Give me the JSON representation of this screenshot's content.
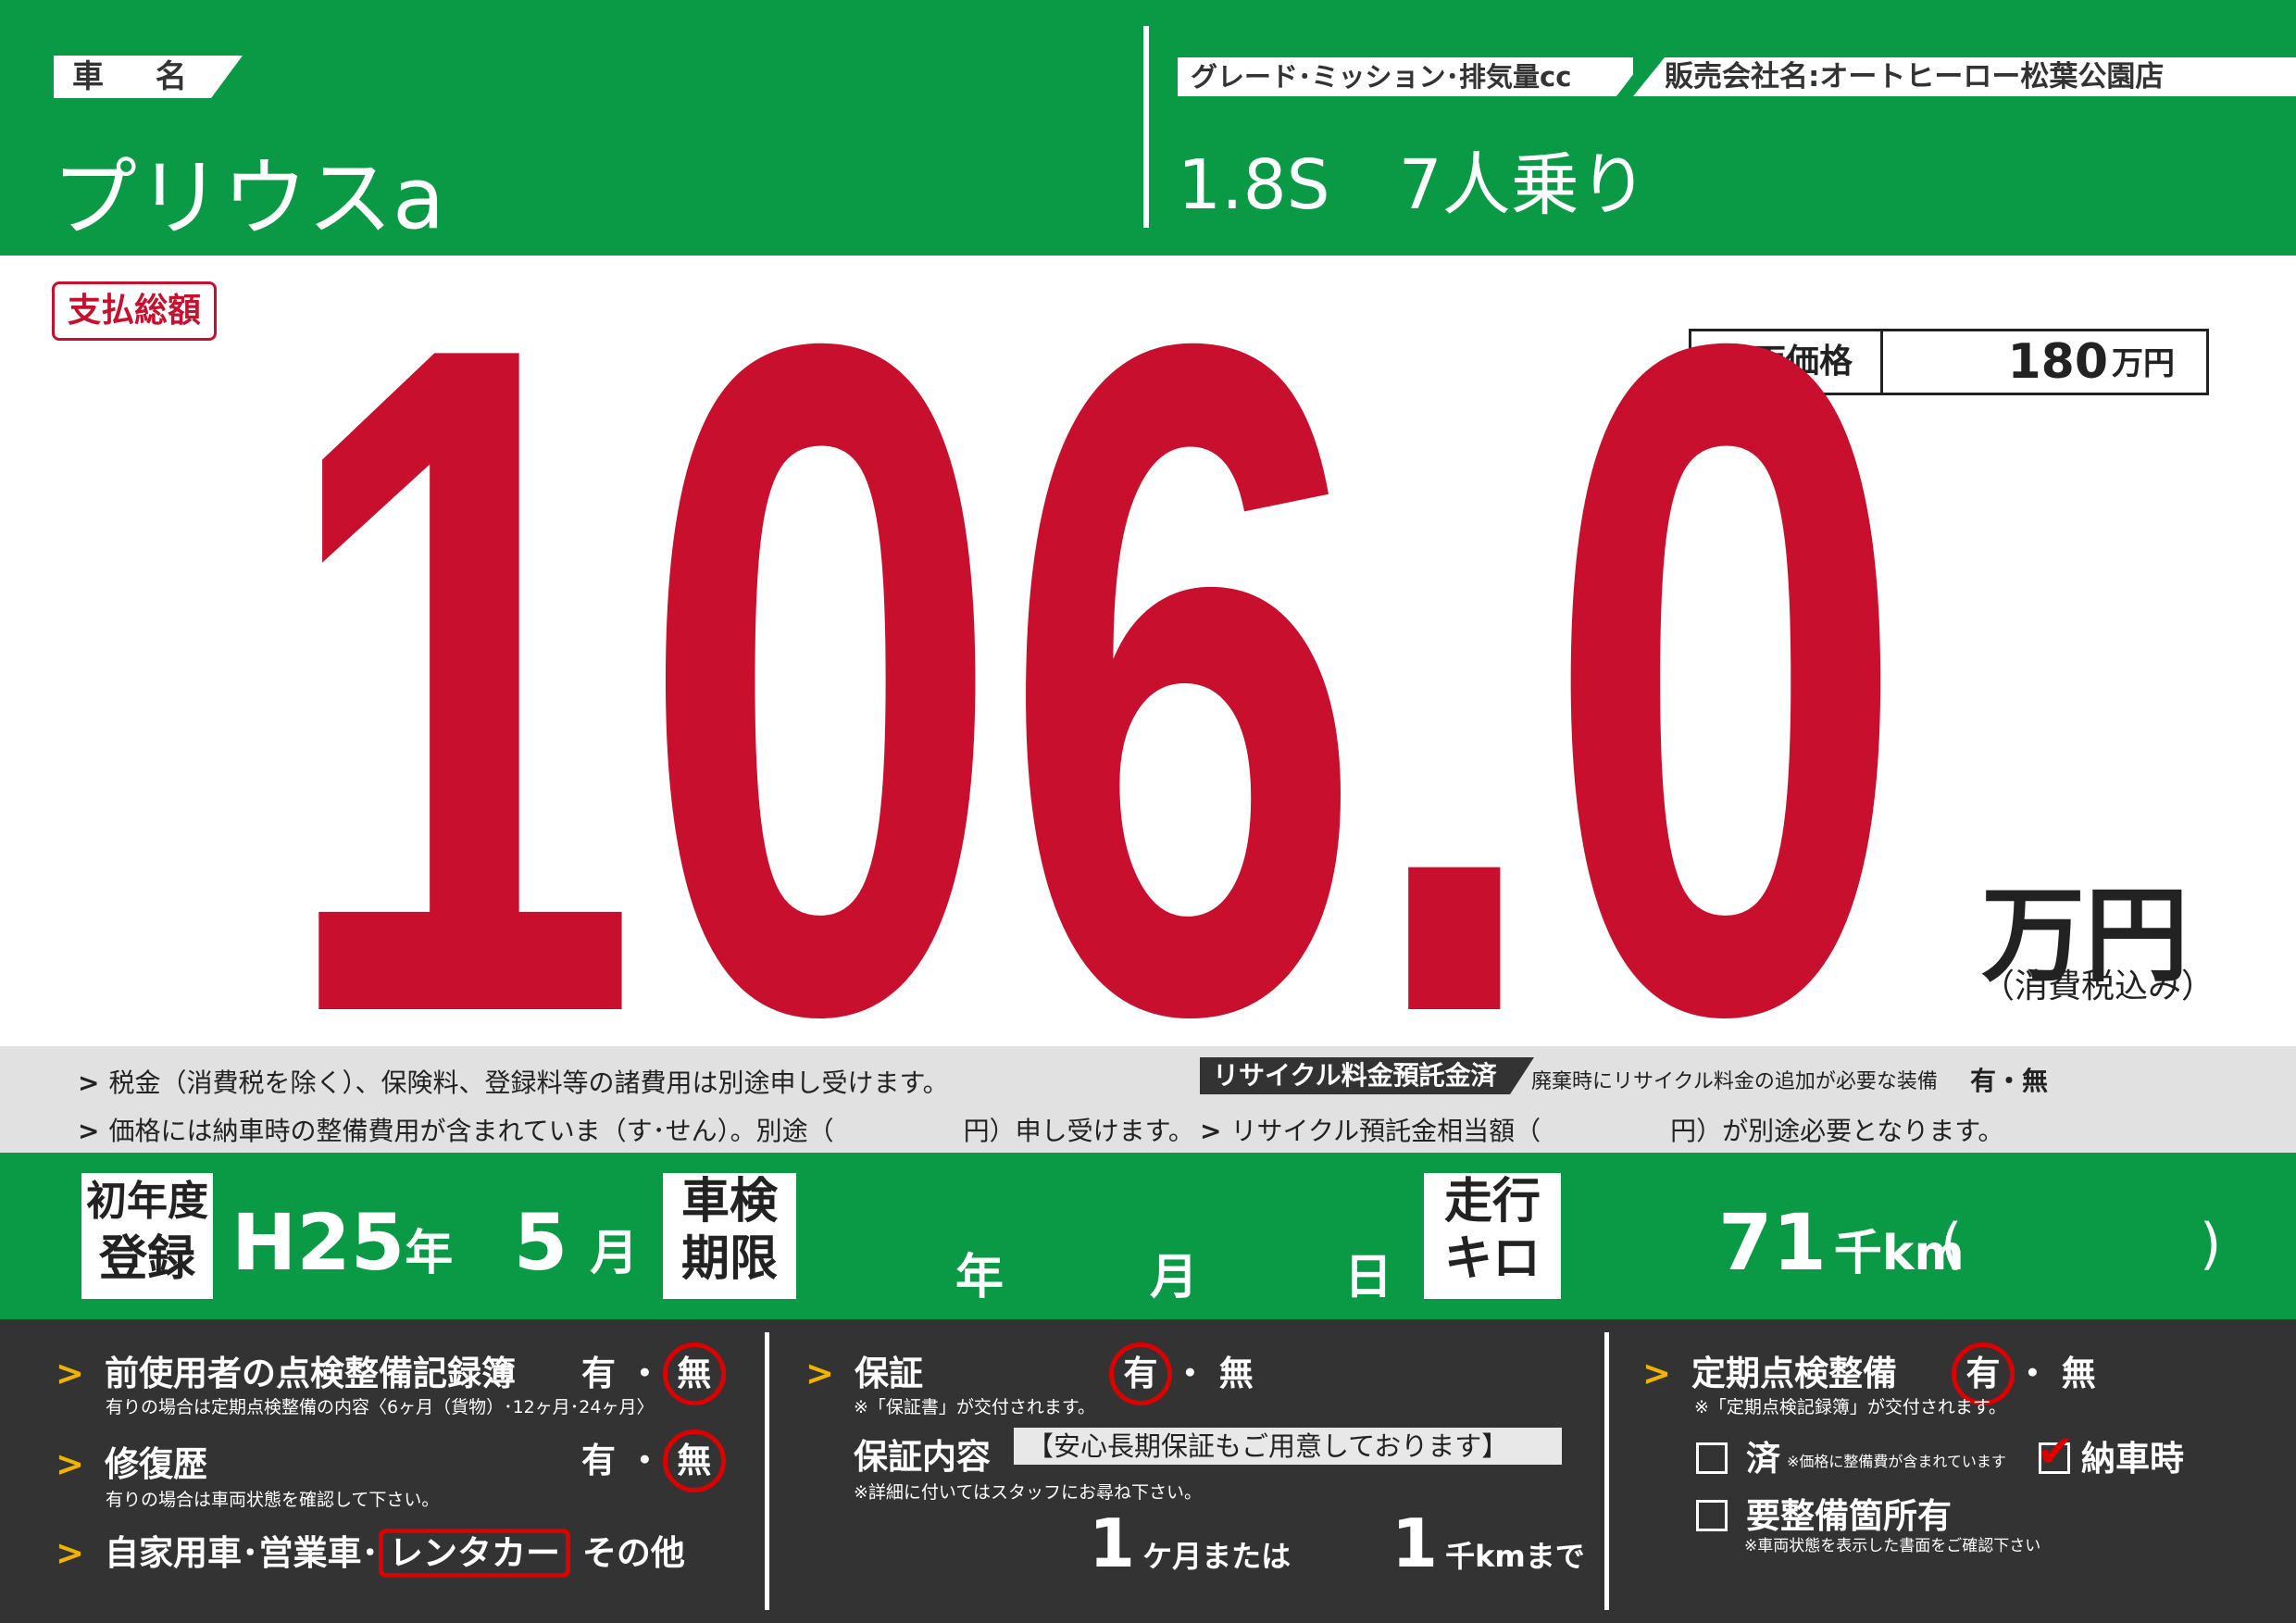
{
  "header": {
    "car_name_label": "車 名",
    "car_name": "プリウスa",
    "grade_label": "グレード･ミッション･排気量cc",
    "dealer_label": "販売会社名:オートヒーロー松葉公園店",
    "grade_value": "1.8S　7人乗り"
  },
  "price": {
    "total_label": "支払総額",
    "vehicle_price_label": "車両価格",
    "vehicle_price_value": "180",
    "vehicle_price_unit": "万円",
    "total_value": "106.0",
    "unit": "万円",
    "tax_note": "（消費税込み）"
  },
  "notes": {
    "line1": "税金（消費税を除く）、保険料、登録料等の諸費用は別途申し受けます。",
    "line2": "価格には納車時の整備費用が含まれていま（す･せん）。別途（　　　　　円）申し受けます。",
    "recycle_tag": "リサイクル料金預託金済",
    "recycle_text": "廃棄時にリサイクル料金の追加が必要な装備",
    "recycle_yesno": "有・無",
    "recycle_line": "リサイクル預託金相当額（　　　　　円）が別途必要となります。"
  },
  "info": {
    "first_reg_label_1": "初年度",
    "first_reg_label_2": "登録",
    "first_reg_year": "H25",
    "year_unit": "年",
    "first_reg_month": "5",
    "month_unit": "月",
    "inspection_label_1": "車検",
    "inspection_label_2": "期限",
    "inspection_year_unit": "年",
    "inspection_month_unit": "月",
    "inspection_day_unit": "日",
    "mileage_label_1": "走行",
    "mileage_label_2": "キロ",
    "mileage_value": "71",
    "mileage_unit": "千km",
    "mileage_paren_open": "(",
    "mileage_paren_close": ")"
  },
  "details": {
    "record_book": "前使用者の点検整備記録簿",
    "record_yes": "有",
    "record_no": "無",
    "record_note": "有りの場合は定期点検整備の内容〈6ヶ月（貨物）･12ヶ月･24ヶ月〉",
    "repair_history": "修復歴",
    "repair_yes": "有",
    "repair_no": "無",
    "repair_note": "有りの場合は車両状態を確認して下さい。",
    "use_private": "自家用車･営業車･",
    "use_rental": "レンタカー",
    "use_other": "その他",
    "warranty": "保証",
    "warranty_yes": "有",
    "warranty_no": "無",
    "warranty_note": "※「保証書」が交付されます。",
    "warranty_content_label": "保証内容",
    "warranty_content": "【安心長期保証もご用意しております】",
    "warranty_detail_note": "※詳細に付いてはスタッフにお尋ね下さい。",
    "warranty_months": "1",
    "warranty_months_unit": "ケ月または",
    "warranty_km": "1",
    "warranty_km_unit": "千kmまで",
    "periodic": "定期点検整備",
    "periodic_yes": "有",
    "periodic_no": "無",
    "periodic_note": "※「定期点検記録簿」が交付されます。",
    "done_label": "済",
    "done_note": "※価格に整備費が含まれています",
    "delivery_label": "納車時",
    "needs_maintenance": "要整備箇所有",
    "needs_note": "※車両状態を表示した書面をご確認下さい"
  },
  "colors": {
    "green": "#0a9a45",
    "red": "#c8102e",
    "dark": "#333333"
  }
}
